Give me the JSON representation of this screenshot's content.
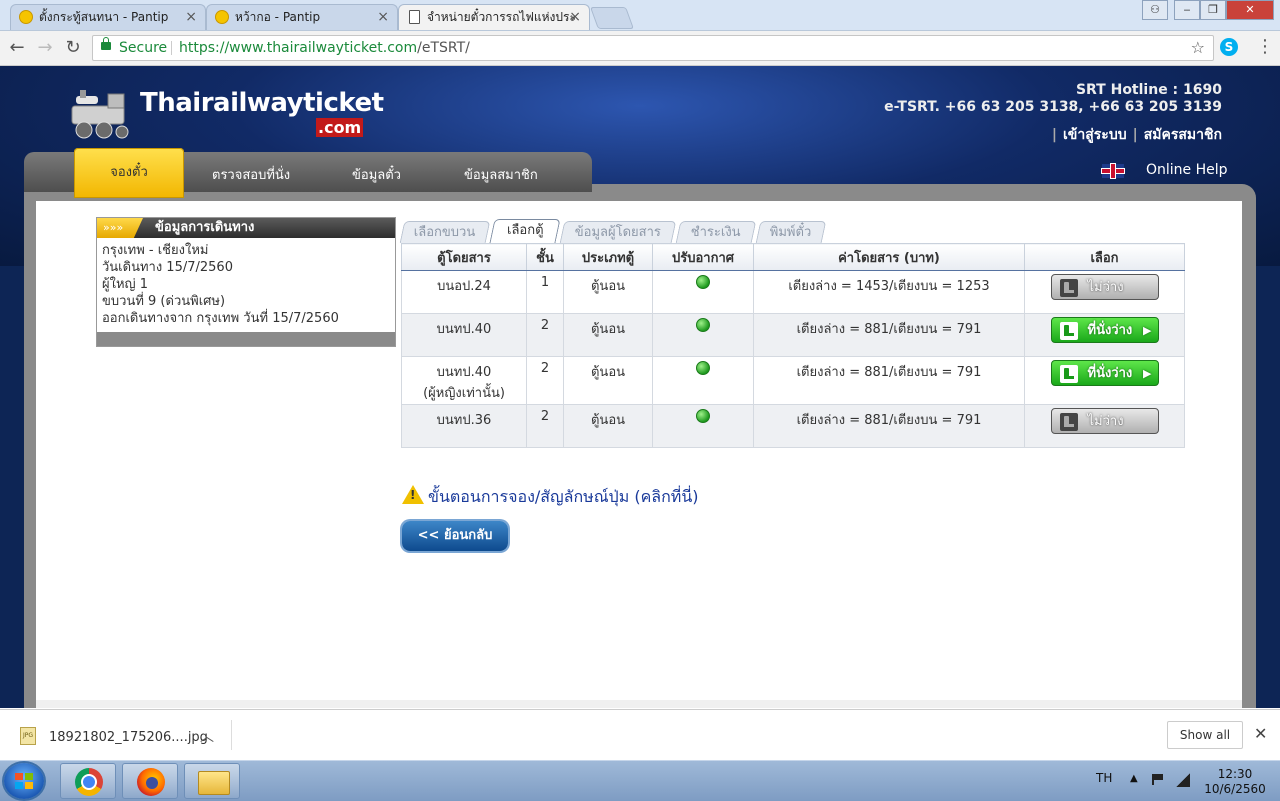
{
  "browser": {
    "tabs": [
      {
        "label": "ตั้งกระทู้สนทนา - Pantip",
        "active": false
      },
      {
        "label": "หว้ากอ - Pantip",
        "active": false
      },
      {
        "label": "จำหน่ายตั๋วการรถไฟแห่งประ",
        "active": true
      }
    ],
    "close_glyph": "×",
    "secure_label": "Secure",
    "url_host": "https://www.thairailwayticket.com",
    "url_path": "/eTSRT/"
  },
  "site": {
    "logo_text": "Thairailwayticket",
    "logo_suffix": ".com",
    "hotline": "SRT Hotline : 1690",
    "contact": "e-TSRT. +66 63 205 3138, +66 63 205 3139",
    "login_link": "เข้าสู่ระบบ",
    "register_link": "สมัครสมาชิก",
    "online_help": "Online Help",
    "menu": {
      "booking": "จองตั๋ว",
      "check_seat": "ตรวจสอบที่นั่ง",
      "ticket_info": "ข้อมูลตั๋ว",
      "member_info": "ข้อมูลสมาชิก"
    }
  },
  "sidebar": {
    "tag": "»»»",
    "title": "ข้อมูลการเดินทาง",
    "route": "กรุงเทพ - เชียงใหม่",
    "travel_date": "วันเดินทาง 15/7/2560",
    "passengers": "ผู้ใหญ่ 1",
    "train": "ขบวนที่ 9 (ด่วนพิเศษ)",
    "departure": "ออกเดินทางจาก กรุงเทพ วันที่ 15/7/2560"
  },
  "steps": {
    "select_train": "เลือกขบวน",
    "select_car": "เลือกตู้",
    "passenger_info": "ข้อมูลผู้โดยสาร",
    "payment": "ชำระเงิน",
    "print": "พิมพ์ตั๋ว"
  },
  "table": {
    "headers": {
      "car": "ตู้โดยสาร",
      "class": "ชั้น",
      "type": "ประเภทตู้",
      "aircon": "ปรับอากาศ",
      "fare": "ค่าโดยสาร (บาท)",
      "select": "เลือก"
    },
    "rows": [
      {
        "car": "บนอป.24",
        "car_note": "",
        "class": "1",
        "type": "ตู้นอน",
        "fare": "เตียงล่าง = 1453/เตียงบน = 1253",
        "button": "ไม่ว่าง",
        "available": false
      },
      {
        "car": "บนทป.40",
        "car_note": "",
        "class": "2",
        "type": "ตู้นอน",
        "fare": "เตียงล่าง = 881/เตียงบน = 791",
        "button": "ที่นั่งว่าง",
        "available": true
      },
      {
        "car": "บนทป.40",
        "car_note": "(ผู้หญิงเท่านั้น)",
        "class": "2",
        "type": "ตู้นอน",
        "fare": "เตียงล่าง = 881/เตียงบน = 791",
        "button": "ที่นั่งว่าง",
        "available": true
      },
      {
        "car": "บนทป.36",
        "car_note": "",
        "class": "2",
        "type": "ตู้นอน",
        "fare": "เตียงล่าง = 881/เตียงบน = 791",
        "button": "ไม่ว่าง",
        "available": false
      }
    ],
    "arrow": "▶"
  },
  "help_link": "ขั้นตอนการจอง/สัญลักษณ์ปุ่ม (คลิกที่นี่)",
  "back_button": "<< ย้อนกลับ",
  "download_bar": {
    "file_name": "18921802_175206....jpg",
    "file_type": "JPG",
    "show_all": "Show all"
  },
  "taskbar": {
    "lang": "TH",
    "time": "12:30",
    "date": "10/6/2560"
  },
  "colors": {
    "site_bg": "#0d2555",
    "menu_active": "#f2b600",
    "available_button": "#1aa81a",
    "unavailable_button": "#b0b0b0",
    "back_button": "#0e4a8e"
  }
}
